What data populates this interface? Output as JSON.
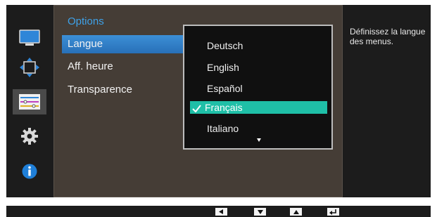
{
  "sidebar": {
    "icons": [
      "monitor-icon",
      "size-position-icon",
      "settings-sliders-icon",
      "gear-icon",
      "info-icon"
    ],
    "active_index": 2
  },
  "panel": {
    "title": "Options",
    "items": [
      {
        "label": "Langue",
        "selected": true
      },
      {
        "label": "Aff. heure",
        "selected": false
      },
      {
        "label": "Transparence",
        "selected": false
      }
    ]
  },
  "dropdown": {
    "options": [
      "Deutsch",
      "English",
      "Español",
      "Français",
      "Italiano"
    ],
    "selected": "Français"
  },
  "help": {
    "text": "Définissez la langue des menus."
  },
  "buttons": [
    "left-arrow-icon",
    "down-arrow-icon",
    "up-arrow-icon",
    "enter-icon"
  ],
  "colors": {
    "accent": "#2f7fc8",
    "selection": "#1fbfa7",
    "title": "#3ea1e8",
    "panel_bg": "#453d36",
    "osd_bg": "#1c1c1c"
  }
}
